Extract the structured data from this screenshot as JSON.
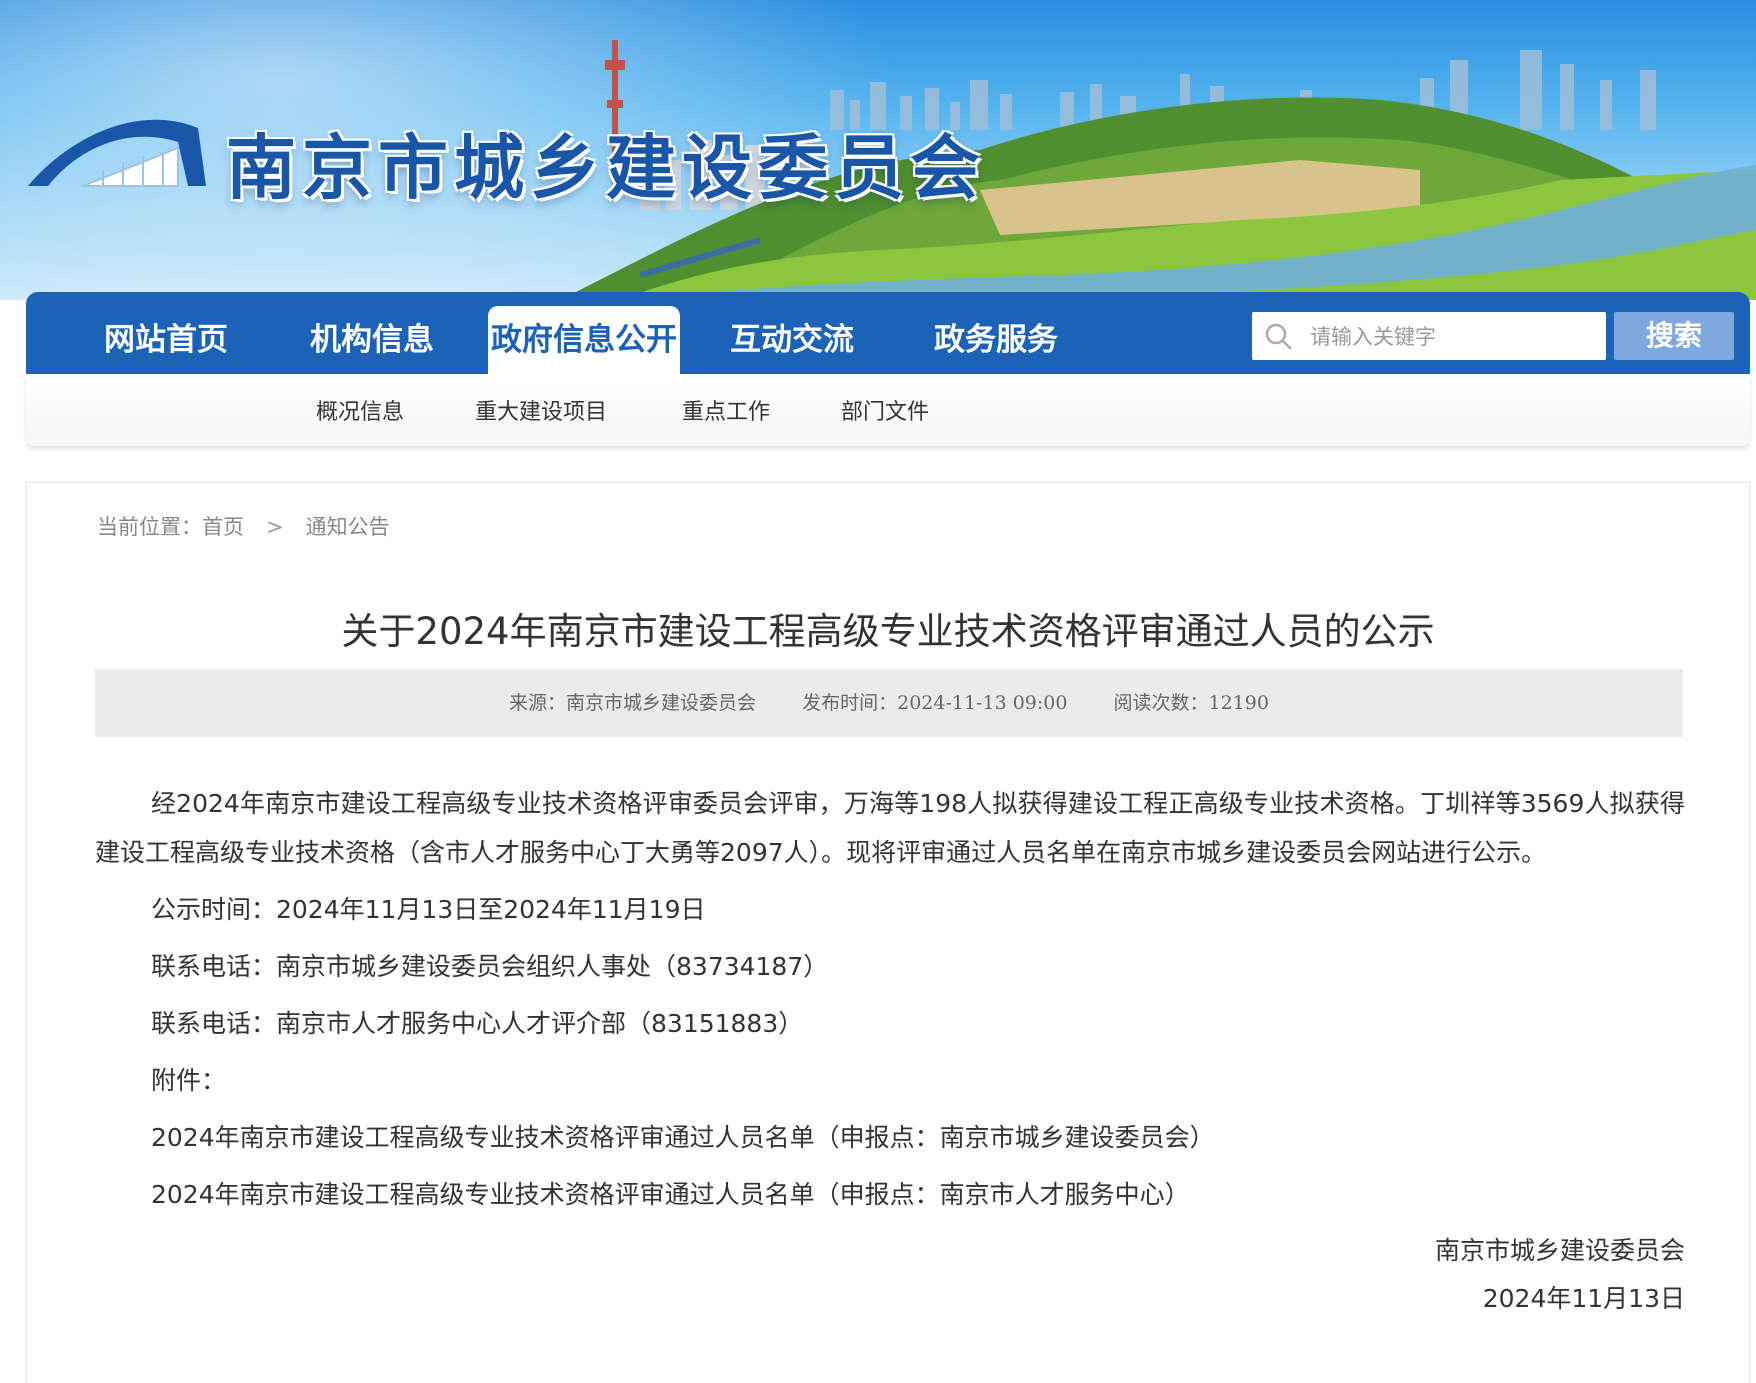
{
  "site": {
    "title": "南京市城乡建设委员会"
  },
  "nav": {
    "items": [
      "网站首页",
      "机构信息",
      "政府信息公开",
      "互动交流",
      "政务服务"
    ],
    "active_index": 2,
    "search_placeholder": "请输入关键字",
    "search_button": "搜索"
  },
  "subnav": {
    "items": [
      "概况信息",
      "重大建设项目",
      "重点工作",
      "部门文件"
    ]
  },
  "breadcrumb": {
    "prefix": "当前位置：",
    "items": [
      "首页",
      "通知公告"
    ],
    "separator": ">"
  },
  "article": {
    "title": "关于2024年南京市建设工程高级专业技术资格评审通过人员的公示",
    "meta": {
      "source": "来源：南京市城乡建设委员会",
      "published": "发布时间：2024-11-13 09:00",
      "views": "阅读次数：12190"
    },
    "paragraph": "经2024年南京市建设工程高级专业技术资格评审委员会评审，万海等198人拟获得建设工程正高级专业技术资格。丁圳祥等3569人拟获得建设工程高级专业技术资格（含市人才服务中心丁大勇等2097人）。现将评审通过人员名单在南京市城乡建设委员会网站进行公示。",
    "period": "公示时间：2024年11月13日至2024年11月19日",
    "contact1": "联系电话：南京市城乡建设委员会组织人事处（83734187）",
    "contact2": "联系电话：南京市人才服务中心人才评介部（83151883）",
    "attachments_label": "附件：",
    "attachments": [
      "2024年南京市建设工程高级专业技术资格评审通过人员名单（申报点：南京市城乡建设委员会）",
      "2024年南京市建设工程高级专业技术资格评审通过人员名单（申报点：南京市人才服务中心）"
    ],
    "signature": "南京市城乡建设委员会",
    "date": "2024年11月13日"
  },
  "colors": {
    "primary": "#1c63b7",
    "search_button": "#7fa9dd",
    "meta_bg": "#ebebeb"
  }
}
